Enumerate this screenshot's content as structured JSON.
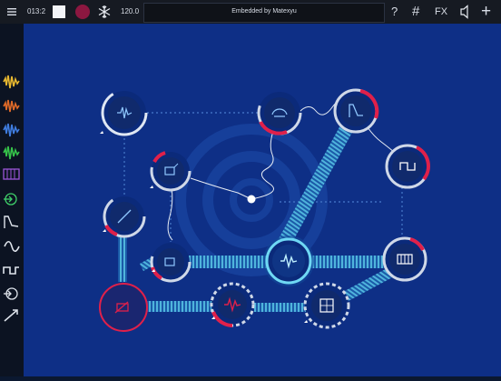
{
  "topbar": {
    "time": "013:2",
    "tempo": "120.0",
    "title": "Embedded by Matexyu",
    "help_label": "?",
    "grid_label": "#",
    "fx_label": "FX",
    "add_label": "+"
  },
  "sidebar": {
    "items": [
      {
        "name": "waveform-yellow-icon",
        "color": "#e8b830"
      },
      {
        "name": "waveform-orange-icon",
        "color": "#e06a28"
      },
      {
        "name": "waveform-blue-icon",
        "color": "#3f7de0"
      },
      {
        "name": "waveform-green-icon",
        "color": "#36c44a"
      },
      {
        "name": "keyboard-icon",
        "color": "#9b55d8"
      },
      {
        "name": "input-icon",
        "color": "#3fd06a"
      },
      {
        "name": "envelope-icon",
        "color": "#dfe4ec"
      },
      {
        "name": "lfo-icon",
        "color": "#dfe4ec"
      },
      {
        "name": "square-wave-icon",
        "color": "#dfe4ec"
      },
      {
        "name": "output-icon",
        "color": "#dfe4ec"
      },
      {
        "name": "slope-icon",
        "color": "#dfe4ec"
      }
    ]
  },
  "colors": {
    "workspace": "#0e2f86",
    "accent_red": "#e0204a",
    "cyan": "#5ec8e8"
  },
  "modules": [
    {
      "name": "oscillator-module",
      "icon": "waveform"
    },
    {
      "name": "sampler-module",
      "icon": "sampler"
    },
    {
      "name": "envelope-module",
      "icon": "envelope"
    },
    {
      "name": "square-lfo-module",
      "icon": "square-wave"
    },
    {
      "name": "processor-module-1",
      "icon": "processor"
    },
    {
      "name": "slope-module",
      "icon": "slope"
    },
    {
      "name": "processor-module-2",
      "icon": "processor"
    },
    {
      "name": "oscillator-module-2",
      "icon": "waveform"
    },
    {
      "name": "keyboard-module",
      "icon": "keyboard"
    },
    {
      "name": "output-module",
      "icon": "output"
    },
    {
      "name": "waveform-module-red",
      "icon": "waveform"
    },
    {
      "name": "grid-module",
      "icon": "grid"
    }
  ]
}
